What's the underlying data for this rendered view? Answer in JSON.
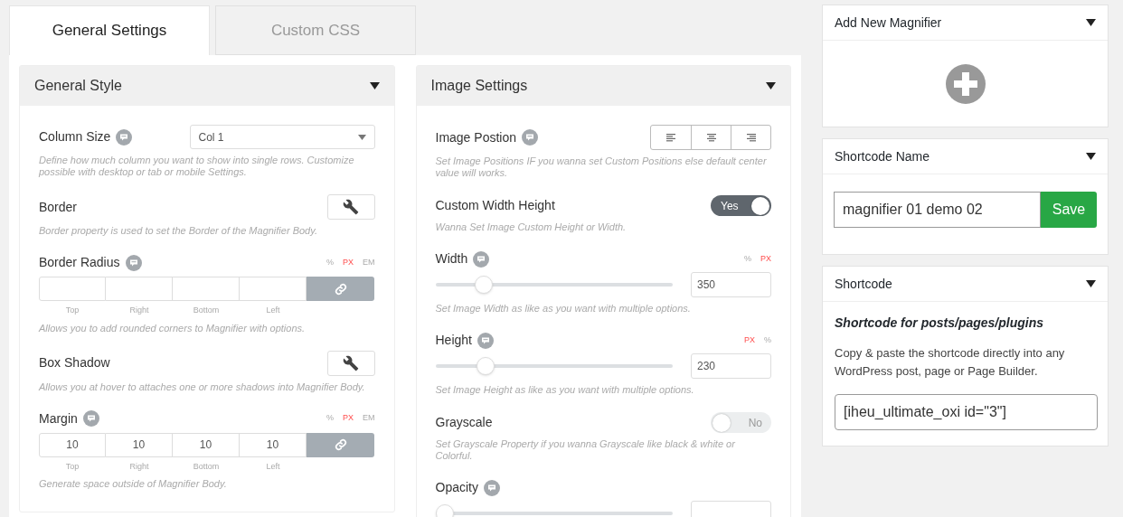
{
  "tabs": [
    {
      "label": "General Settings",
      "selected": true
    },
    {
      "label": "Custom CSS",
      "selected": false
    }
  ],
  "panels": [
    {
      "title": "General Style",
      "fields": [
        {
          "kind": "select",
          "label": "Column Size",
          "info": true,
          "value": "Col 1",
          "help": "Define how much column you want to show into single rows. Customize possible with desktop or tab or mobile Settings."
        },
        {
          "kind": "tool",
          "label": "Border",
          "info": false,
          "help": "Border property is used to set the Border of the Magnifier Body."
        },
        {
          "kind": "dimensions",
          "label": "Border Radius",
          "info": true,
          "units": [
            {
              "label": "%",
              "selected": false
            },
            {
              "label": "PX",
              "selected": true
            },
            {
              "label": "EM",
              "selected": false
            }
          ],
          "sides": [
            {
              "label": "Top"
            },
            {
              "label": "Right"
            },
            {
              "label": "Bottom"
            },
            {
              "label": "Left"
            }
          ],
          "help": "Allows you to add rounded corners to Magnifier with options."
        },
        {
          "kind": "tool",
          "label": "Box Shadow",
          "info": false,
          "help": "Allows you at hover to attaches one or more shadows into Magnifier Body."
        },
        {
          "kind": "dimensions",
          "label": "Margin",
          "info": true,
          "units": [
            {
              "label": "%",
              "selected": false
            },
            {
              "label": "PX",
              "selected": true
            },
            {
              "label": "EM",
              "selected": false
            }
          ],
          "sides": [
            {
              "label": "Top",
              "value": "10"
            },
            {
              "label": "Right",
              "value": "10"
            },
            {
              "label": "Bottom",
              "value": "10"
            },
            {
              "label": "Left",
              "value": "10"
            }
          ],
          "help": "Generate space outside of Magnifier Body."
        }
      ]
    },
    {
      "title": "Image Settings",
      "fields": [
        {
          "kind": "align",
          "label": "Image Postion",
          "info": true,
          "help": "Set Image Positions IF you wanna set Custom Positions else default center value will works."
        },
        {
          "kind": "toggle",
          "label": "Custom Width Height",
          "info": false,
          "on": true,
          "state": "Yes",
          "help": "Wanna Set Image Custom Height or Width."
        },
        {
          "kind": "slider",
          "label": "Width",
          "info": true,
          "units": [
            {
              "label": "%",
              "selected": false
            },
            {
              "label": "PX",
              "selected": true
            }
          ],
          "level": 0.18,
          "value": "350",
          "help": "Set Image Width as like as you want with multiple options."
        },
        {
          "kind": "slider",
          "label": "Height",
          "info": true,
          "units": [
            {
              "label": "PX",
              "selected": true
            },
            {
              "label": "%",
              "selected": false
            }
          ],
          "level": 0.19,
          "value": "230",
          "help": "Set Image Height as like as you want with multiple options."
        },
        {
          "kind": "toggle",
          "label": "Grayscale",
          "info": false,
          "on": false,
          "state": "No",
          "help": "Set Grayscale Property if you wanna Grayscale like black & white or Colorful."
        },
        {
          "kind": "slider",
          "label": "Opacity",
          "info": true,
          "level": 0
        }
      ]
    }
  ],
  "sidebar": [
    {
      "kind": "add",
      "title": "Add New Magnifier"
    },
    {
      "kind": "name",
      "title": "Shortcode Name",
      "value": "magnifier 01 demo 02",
      "button": "Save"
    },
    {
      "kind": "shortcode",
      "title": "Shortcode",
      "subtitle": "Shortcode for posts/pages/plugins",
      "text": "Copy & paste the shortcode directly into any WordPress post, page or Page Builder.",
      "code": "[iheu_ultimate_oxi id=\"3\"]"
    }
  ]
}
